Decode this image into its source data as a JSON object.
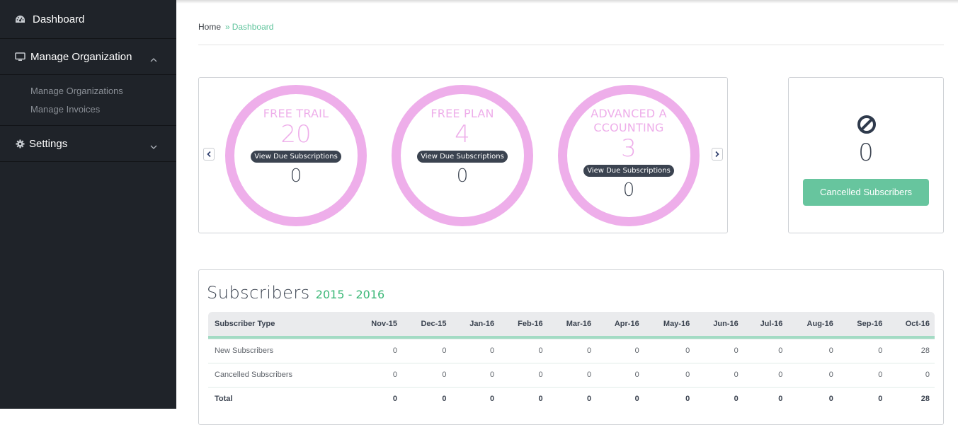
{
  "sidebar": {
    "items": [
      {
        "label": "Dashboard",
        "icon": "dashboard-icon"
      },
      {
        "label": "Manage Organization",
        "icon": "monitor-icon",
        "expanded": true,
        "children": [
          {
            "label": "Manage Organizations"
          },
          {
            "label": "Manage Invoices"
          }
        ]
      },
      {
        "label": "Settings",
        "icon": "gear-icon",
        "expanded": false
      }
    ]
  },
  "breadcrumb": {
    "home": "Home",
    "separator": "»",
    "current": "Dashboard"
  },
  "plans": [
    {
      "name": "FREE TRAIL",
      "count": "20",
      "due_label": "View Due Subscriptions",
      "due_count": "0"
    },
    {
      "name": "FREE PLAN",
      "count": "4",
      "due_label": "View Due Subscriptions",
      "due_count": "0"
    },
    {
      "name": "ADVANCED A CCOUNTING",
      "count": "3",
      "due_label": "View Due Subscriptions",
      "due_count": "0"
    }
  ],
  "carousel": {
    "prev": "‹",
    "next": "›"
  },
  "cancelled": {
    "count": "0",
    "button_label": "Cancelled Subscribers"
  },
  "subscribers": {
    "title": "Subscribers",
    "range": "2015 - 2016",
    "columns": [
      "Subscriber Type",
      "Nov-15",
      "Dec-15",
      "Jan-16",
      "Feb-16",
      "Mar-16",
      "Apr-16",
      "May-16",
      "Jun-16",
      "Jul-16",
      "Aug-16",
      "Sep-16",
      "Oct-16"
    ],
    "rows": [
      {
        "type": "New Subscribers",
        "values": [
          "0",
          "0",
          "0",
          "0",
          "0",
          "0",
          "0",
          "0",
          "0",
          "0",
          "0",
          "28"
        ]
      },
      {
        "type": "Cancelled Subscribers",
        "values": [
          "0",
          "0",
          "0",
          "0",
          "0",
          "0",
          "0",
          "0",
          "0",
          "0",
          "0",
          "0"
        ]
      },
      {
        "type": "Total",
        "values": [
          "0",
          "0",
          "0",
          "0",
          "0",
          "0",
          "0",
          "0",
          "0",
          "0",
          "0",
          "28"
        ]
      }
    ]
  },
  "colors": {
    "accent_green": "#67c59e",
    "plan_pink": "#eeaeea",
    "sidebar_bg": "#1f2329",
    "dark_text": "#3b4350"
  }
}
